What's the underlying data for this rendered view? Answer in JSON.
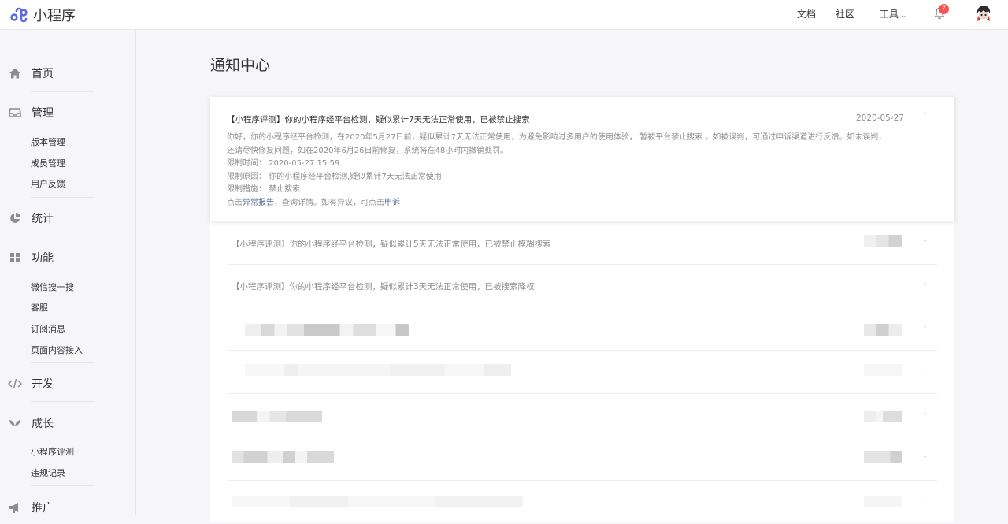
{
  "header": {
    "logo_text": "小程序",
    "links": [
      "文档",
      "社区"
    ],
    "tools_label": "工具",
    "notification_count": "7"
  },
  "sidebar": {
    "groups": [
      {
        "label": "首页",
        "icon": "home-icon",
        "items": []
      },
      {
        "label": "管理",
        "icon": "inbox-icon",
        "items": [
          "版本管理",
          "成员管理",
          "用户反馈"
        ]
      },
      {
        "label": "统计",
        "icon": "pie-chart-icon",
        "items": []
      },
      {
        "label": "功能",
        "icon": "grid-icon",
        "items": [
          "微信搜一搜",
          "客服",
          "订阅消息",
          "页面内容接入"
        ]
      },
      {
        "label": "开发",
        "icon": "code-icon",
        "items": []
      },
      {
        "label": "成长",
        "icon": "sprout-icon",
        "items": [
          "小程序评测",
          "违规记录"
        ]
      },
      {
        "label": "推广",
        "icon": "megaphone-icon",
        "items": []
      }
    ]
  },
  "main": {
    "title": "通知中心",
    "expanded_notice": {
      "title": "【小程序评测】你的小程序经平台检测，疑似累计7天无法正常使用，已被禁止搜索",
      "date": "2020-05-27",
      "body_line1": "你好，你的小程序经平台检测，在2020年5月27日前，疑似累计7天无法正常使用，为避免影响过多用户的使用体验， 暂被平台禁止搜索 。如被误判，可通过申诉渠道进行反馈。如未误判，",
      "body_line2": "还请尽快修复问题，如在2020年6月26日前修复，系统将在48小时内撤销处罚。",
      "time_label": "限制时间：",
      "time_value": "2020-05-27 15:59",
      "reason_label": "限制原因：",
      "reason_value": "你的小程序经平台检测,疑似累计7天无法正常使用",
      "measure_label": "限制措施：",
      "measure_value": "禁止搜索",
      "footer_prefix": "点击",
      "report_link": "异常报告",
      "footer_mid": "，查询详情。如有异议，可点击",
      "appeal_link": "申诉"
    },
    "notices": [
      "【小程序评测】你的小程序经平台检测，疑似累计5天无法正常使用，已被禁止模糊搜索",
      "【小程序评测】你的小程序经平台检测，疑似累计3天无法正常使用，已被搜索降权"
    ]
  }
}
